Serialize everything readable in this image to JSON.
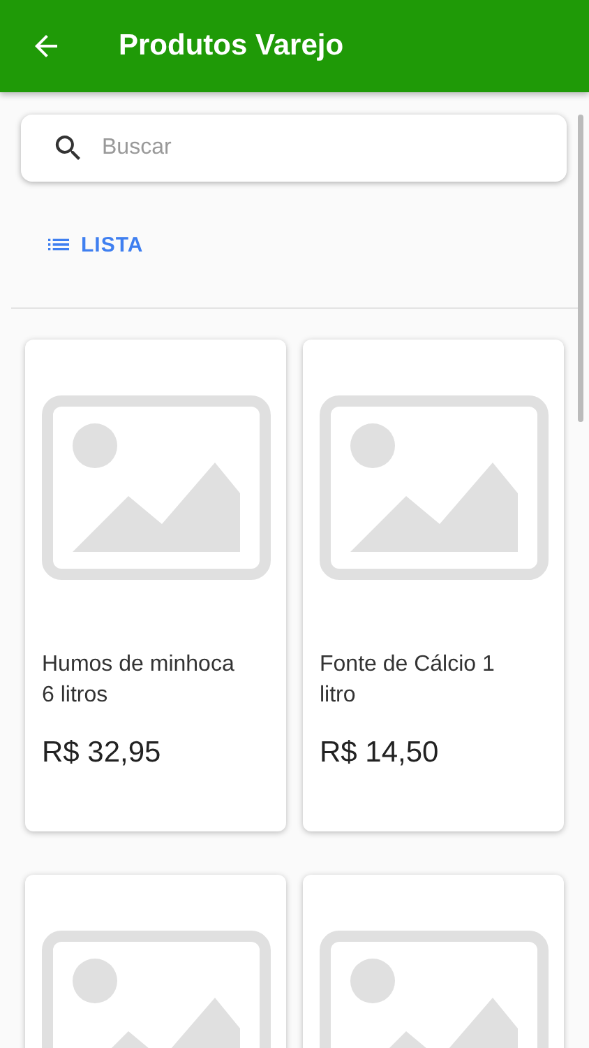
{
  "header": {
    "title": "Produtos Varejo"
  },
  "search": {
    "placeholder": "Buscar"
  },
  "view_toggle": {
    "label": "LISTA"
  },
  "products": [
    {
      "kind": "full",
      "name": "Humos de minhoca 6 litros",
      "price": "R$ 32,95"
    },
    {
      "kind": "full",
      "name": "Fonte de Cálcio 1 litro",
      "price": "R$ 14,50"
    },
    {
      "kind": "image-only"
    },
    {
      "kind": "image-only"
    }
  ]
}
